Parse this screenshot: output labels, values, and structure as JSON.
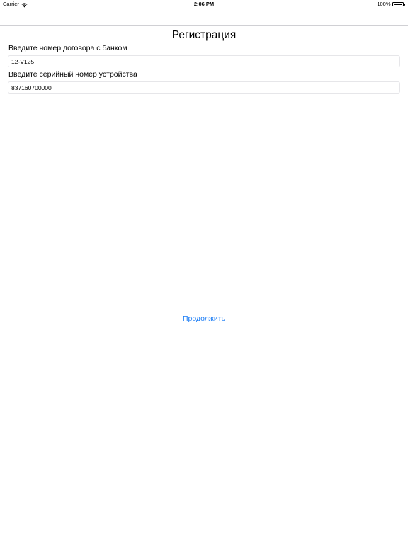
{
  "status_bar": {
    "carrier": "Carrier",
    "time": "2:06 PM",
    "battery_percent": "100%",
    "battery_level": 1.0,
    "wifi_icon": "wifi-icon",
    "battery_icon": "battery-icon"
  },
  "page": {
    "title": "Регистрация"
  },
  "form": {
    "contract_label": "Введите номер договора с банком",
    "contract_value": "12-V125",
    "serial_label": "Введите серийный номер устройства",
    "serial_value": "837160700000"
  },
  "actions": {
    "continue_label": "Продолжить"
  },
  "colors": {
    "accent": "#1a7cf5",
    "separator": "#d0d0d4",
    "field_border": "#e6e6e9"
  }
}
